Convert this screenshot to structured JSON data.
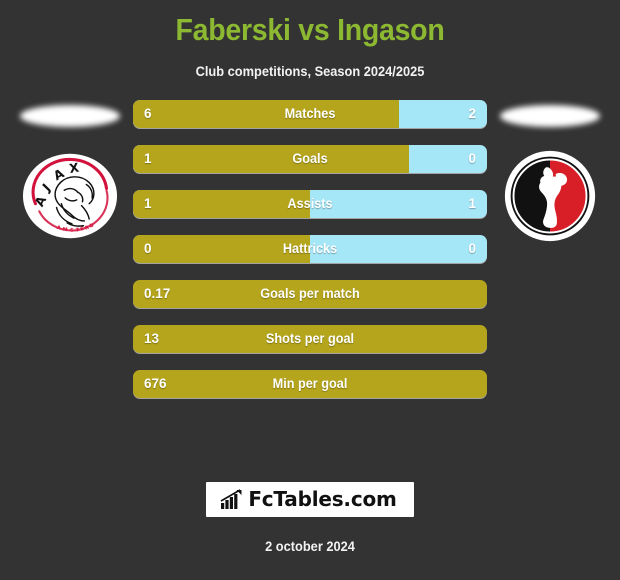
{
  "header": {
    "title": "Faberski vs Ingason",
    "subtitle": "Club competitions, Season 2024/2025",
    "title_color": "#8CB832"
  },
  "teams": {
    "home": {
      "badge": "ajax-amsterdam-crest",
      "color": "#B5A51C"
    },
    "away": {
      "badge": "red-black-rooster-crest",
      "color": "#A5E6F7"
    }
  },
  "chart_data": {
    "type": "bar",
    "title": "Faberski vs Ingason",
    "subtitle": "Club competitions, Season 2024/2025",
    "categories": [
      "Matches",
      "Goals",
      "Assists",
      "Hattricks",
      "Goals per match",
      "Shots per goal",
      "Min per goal"
    ],
    "series": [
      {
        "name": "Faberski",
        "values": [
          "6",
          "1",
          "1",
          "0",
          "0.17",
          "13",
          "676"
        ]
      },
      {
        "name": "Ingason",
        "values": [
          "2",
          "0",
          "1",
          "0",
          null,
          null,
          null
        ]
      }
    ],
    "home_fill_percent": [
      75,
      78,
      50,
      50,
      100,
      100,
      100
    ],
    "colors": {
      "home": "#B5A51C",
      "away": "#A5E6F7"
    }
  },
  "stats": [
    {
      "label": "Matches",
      "home": "6",
      "away": "2",
      "home_pct": 75,
      "split": true
    },
    {
      "label": "Goals",
      "home": "1",
      "away": "0",
      "home_pct": 78,
      "split": true
    },
    {
      "label": "Assists",
      "home": "1",
      "away": "1",
      "home_pct": 50,
      "split": true
    },
    {
      "label": "Hattricks",
      "home": "0",
      "away": "0",
      "home_pct": 50,
      "split": true
    },
    {
      "label": "Goals per match",
      "home": "0.17",
      "away": null,
      "home_pct": 100,
      "split": false
    },
    {
      "label": "Shots per goal",
      "home": "13",
      "away": null,
      "home_pct": 100,
      "split": false
    },
    {
      "label": "Min per goal",
      "home": "676",
      "away": null,
      "home_pct": 100,
      "split": false
    }
  ],
  "footer": {
    "watermark_text": "FcTables.com",
    "watermark_icon": "bar-chart-arrow-icon",
    "date": "2 october 2024"
  }
}
